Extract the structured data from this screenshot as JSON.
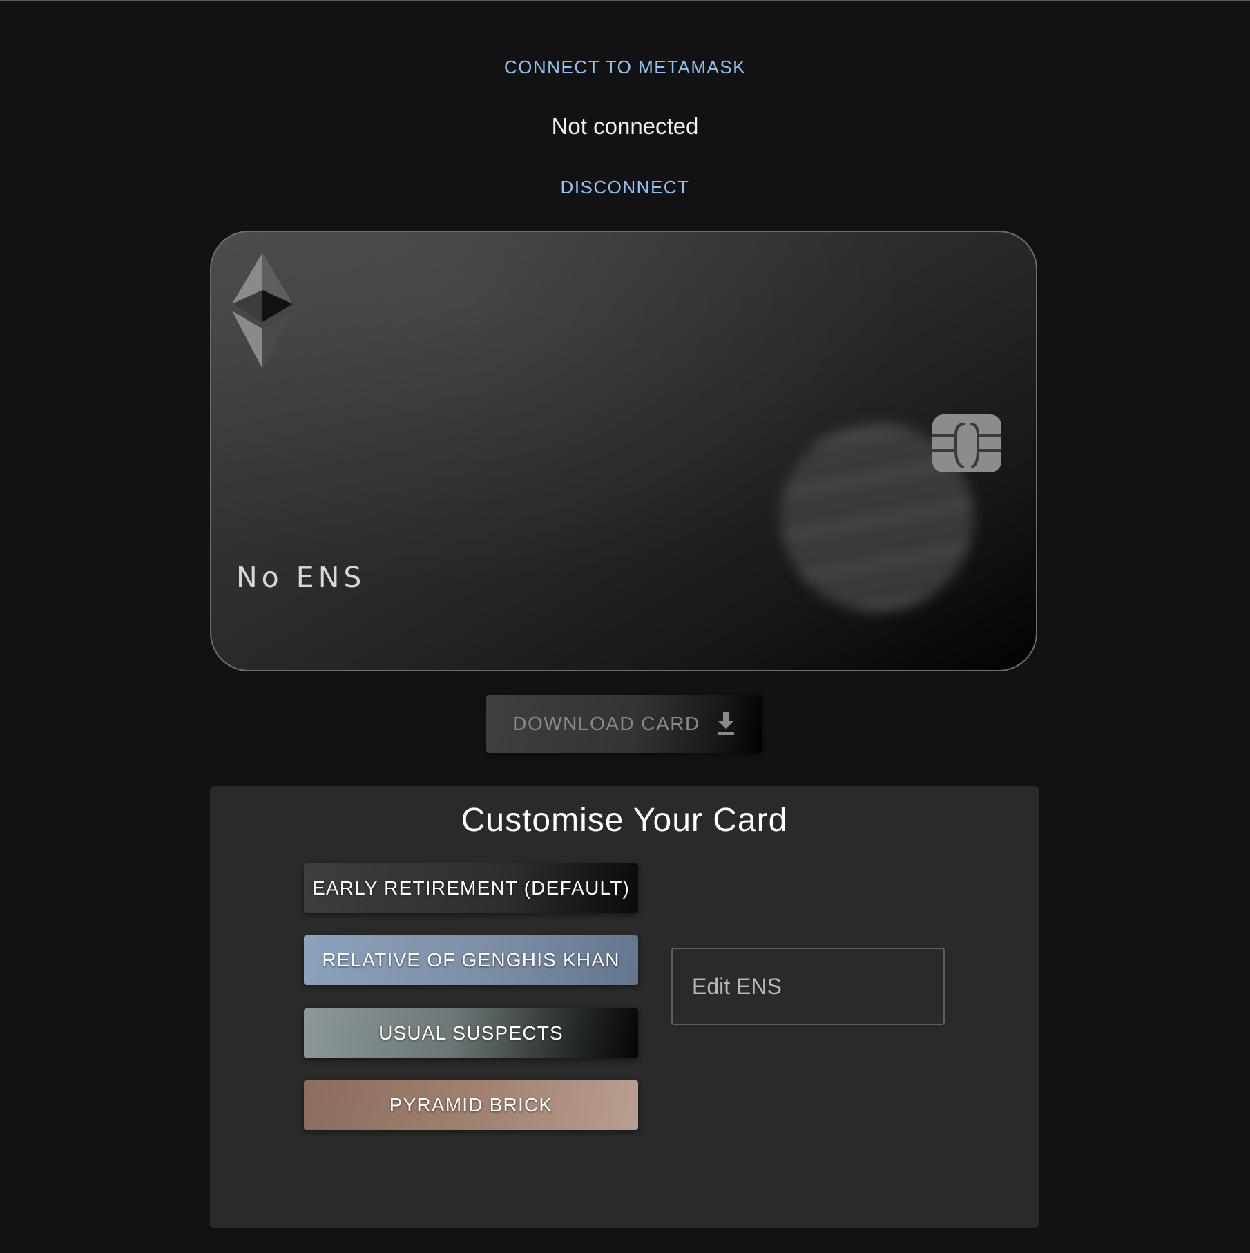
{
  "header": {
    "connect_label": "CONNECT TO METAMASK",
    "status_text": "Not connected",
    "disconnect_label": "DISCONNECT"
  },
  "card": {
    "logo_icon": "ethereum-icon",
    "chip_icon": "sim-chip-icon",
    "ens_name": "No ENS"
  },
  "download": {
    "label": "DOWNLOAD CARD",
    "icon": "download-icon"
  },
  "customise": {
    "title": "Customise Your Card",
    "themes": [
      {
        "label": "EARLY RETIREMENT (DEFAULT)",
        "color": "#2e2e2e"
      },
      {
        "label": "RELATIVE OF GENGHIS KHAN",
        "color": "#7d8ea6"
      },
      {
        "label": "USUAL SUSPECTS",
        "color": "#6c7676"
      },
      {
        "label": "PYRAMID BRICK",
        "color": "#a0806f"
      }
    ],
    "ens_input": {
      "placeholder": "Edit ENS",
      "value": ""
    }
  },
  "colors": {
    "background": "#121212",
    "link": "#90c2f5",
    "panel": "#2a2a2a"
  }
}
